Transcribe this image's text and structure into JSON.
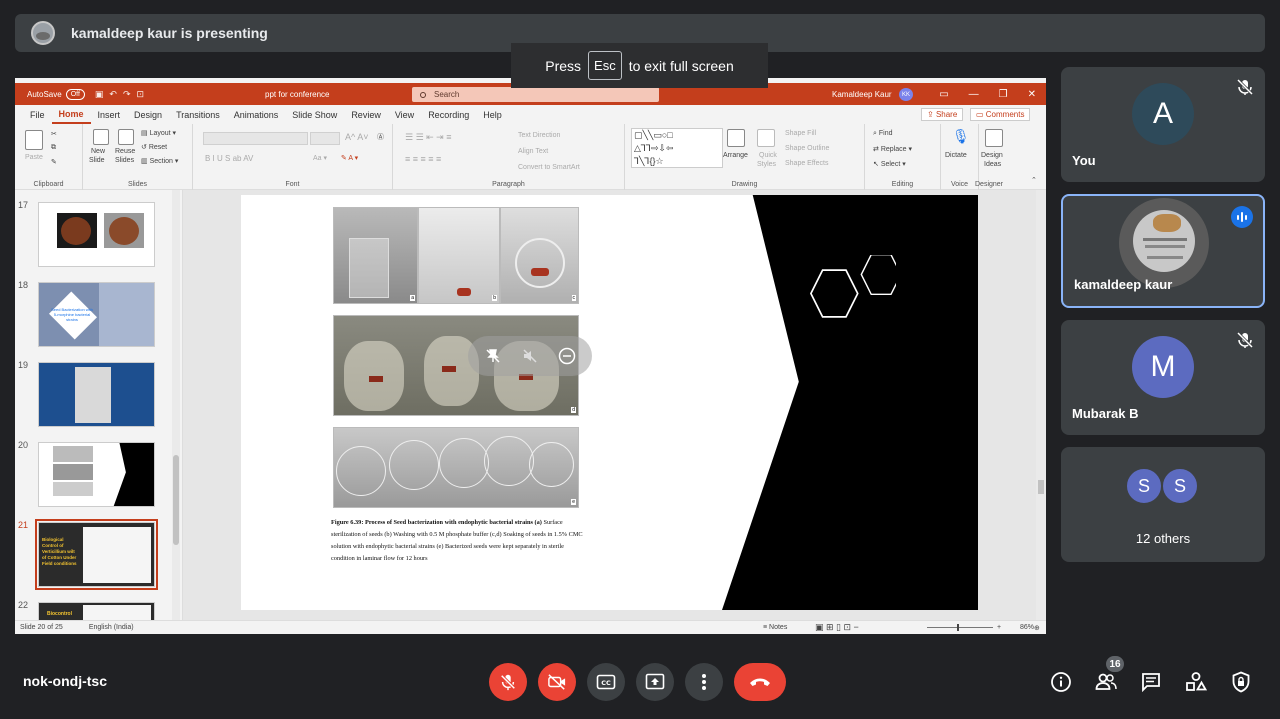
{
  "presenter": {
    "text": "kamaldeep kaur is presenting"
  },
  "fullscreen_hint": {
    "before": "Press",
    "key": "Esc",
    "after": "to exit full screen"
  },
  "powerpoint": {
    "autosave_label": "AutoSave",
    "autosave_state": "Off",
    "file_name": "ppt for conference",
    "search_placeholder": "Search",
    "user_name": "Kamaldeep Kaur",
    "user_initials": "KK",
    "menu": [
      "File",
      "Home",
      "Insert",
      "Design",
      "Transitions",
      "Animations",
      "Slide Show",
      "Review",
      "View",
      "Recording",
      "Help"
    ],
    "share_label": "Share",
    "comments_label": "Comments",
    "ribbon": {
      "clipboard": {
        "label": "Clipboard",
        "paste": "Paste"
      },
      "slides": {
        "label": "Slides",
        "new_slide": "New",
        "new_slide2": "Slide",
        "reuse": "Reuse",
        "reuse2": "Slides",
        "layout": "Layout",
        "reset": "Reset",
        "section": "Section"
      },
      "font": {
        "label": "Font",
        "aa": "Aa"
      },
      "paragraph": {
        "label": "Paragraph",
        "text_direction": "Text Direction",
        "align_text": "Align Text",
        "smartart": "Convert to SmartArt"
      },
      "drawing": {
        "label": "Drawing",
        "arrange": "Arrange",
        "quick_styles": "Quick",
        "quick_styles2": "Styles",
        "shape_fill": "Shape Fill",
        "shape_outline": "Shape Outline",
        "shape_effects": "Shape Effects"
      },
      "editing": {
        "label": "Editing",
        "find": "Find",
        "replace": "Replace",
        "select": "Select"
      },
      "voice": {
        "label": "Voice",
        "dictate": "Dictate"
      },
      "designer": {
        "label": "Designer",
        "design": "Design",
        "ideas": "Ideas"
      }
    },
    "thumbnails": [
      {
        "num": "17"
      },
      {
        "num": "18",
        "text": "Seed Bacterization with 5-morphine bacterial strains"
      },
      {
        "num": "19"
      },
      {
        "num": "20"
      },
      {
        "num": "21",
        "text": "Biological Control of Verticillium wilt of Cotton Under Field conditions"
      },
      {
        "num": "22",
        "text": "Biocontrol"
      }
    ],
    "caption": {
      "bold": "Figure 6.39: Process of Seed bacterization with endophytic bacterial strains (a)",
      "rest": " Surface sterilization of seeds (b) Washing with 0.5 M phosphate buffer (c,d) Soaking of seeds in 1.5% CMC solution with endophytic bacterial strains (e) Bacterized seeds were kept separately in sterile condition in laminar flow for 12 hours"
    },
    "photo_labels": [
      "a",
      "b",
      "c",
      "d",
      "e"
    ],
    "status": {
      "slide": "Slide 20 of 25",
      "language": "English (India)",
      "notes": "Notes",
      "zoom": "86%"
    }
  },
  "participants": [
    {
      "name": "You",
      "initial": "A",
      "avatar_color": "#2e4a5a",
      "muted": true
    },
    {
      "name": "kamaldeep kaur",
      "speaking": true
    },
    {
      "name": "Mubarak B",
      "initial": "M",
      "avatar_color": "#5c6bc0",
      "muted": true
    },
    {
      "name": "12 others",
      "initials": [
        "S",
        "S"
      ]
    }
  ],
  "meeting_code": "nok-ondj-tsc",
  "people_count": "16",
  "colors": {
    "end_call": "#ea4335",
    "accent": "#1a73e8",
    "ppt_red": "#c43e1c"
  }
}
